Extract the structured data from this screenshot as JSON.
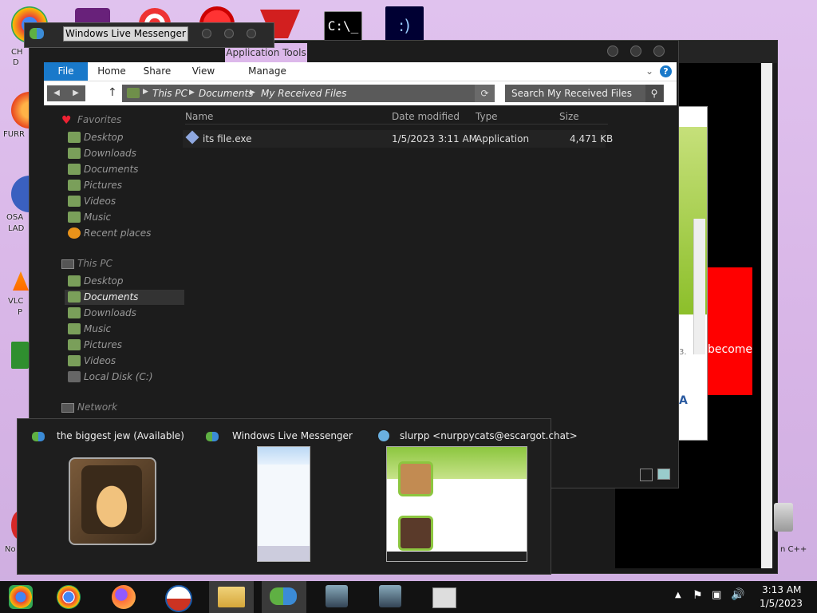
{
  "desktop": {
    "labels": [
      "CH",
      "D",
      "FURR",
      "OSA",
      "LAD",
      "VLC",
      "P",
      "No"
    ],
    "right_labels": [
      "n C++"
    ]
  },
  "messenger_window": {
    "title": "Windows Live Messenger"
  },
  "bg_window": {
    "partial_text": "become",
    "small_char": "3.",
    "a_char": "A"
  },
  "explorer": {
    "ribbon": {
      "contextual_group": "Application Tools",
      "tabs": [
        "File",
        "Home",
        "Share",
        "View",
        "Manage"
      ],
      "help": "?"
    },
    "address": {
      "crumbs": [
        "This PC",
        "Documents",
        "My Received Files"
      ],
      "search_placeholder": "Search My Received Files"
    },
    "nav": {
      "favorites": {
        "label": "Favorites",
        "items": [
          "Desktop",
          "Downloads",
          "Documents",
          "Pictures",
          "Videos",
          "Music",
          "Recent places"
        ]
      },
      "this_pc": {
        "label": "This PC",
        "items": [
          "Desktop",
          "Documents",
          "Downloads",
          "Music",
          "Pictures",
          "Videos",
          "Local Disk (C:)"
        ]
      },
      "network": {
        "label": "Network"
      }
    },
    "columns": [
      "Name",
      "Date modified",
      "Type",
      "Size"
    ],
    "files": [
      {
        "name": "its file.exe",
        "date": "1/5/2023 3:11 AM",
        "type": "Application",
        "size": "4,471 KB"
      }
    ]
  },
  "previews": [
    {
      "title": "the biggest jew (Available)"
    },
    {
      "title": "Windows Live Messenger"
    },
    {
      "title": "slurpp <nurppycats@escargot.chat>"
    }
  ],
  "taskbar": {
    "time": "3:13 AM",
    "date": "1/5/2023"
  },
  "colors": {
    "accent": "#1979ca",
    "desktop": "#d7b4e6",
    "red_box": "#ff0000"
  }
}
